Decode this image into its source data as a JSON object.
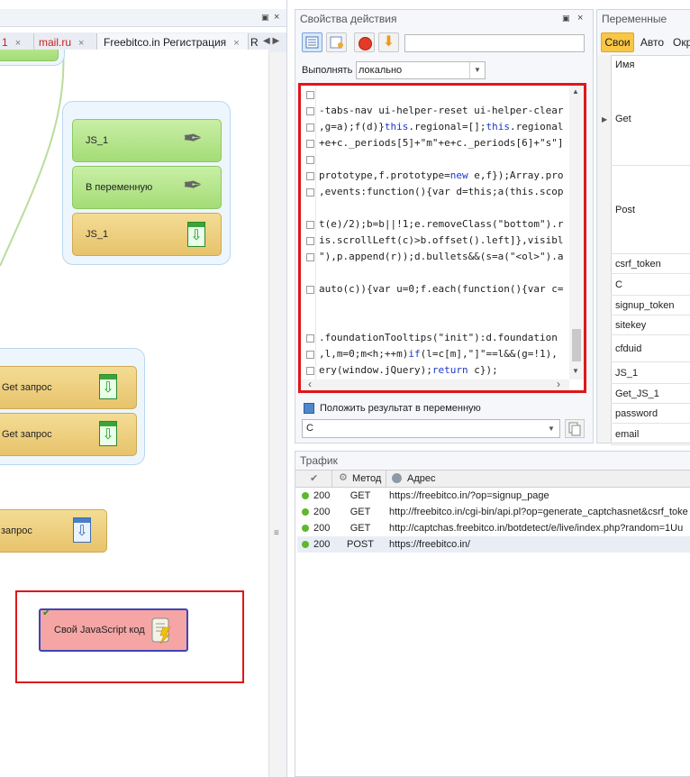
{
  "left_panel": {
    "tabs": [
      {
        "label": "1",
        "red": true
      },
      {
        "label": "mail.ru",
        "red": true
      },
      {
        "label": "Freebitco.in Регистрация",
        "red": false
      },
      {
        "label": "R",
        "red": false
      }
    ],
    "close_glyph": "×",
    "blocks": {
      "js1_top": "JS_1",
      "to_var": "В переменную",
      "js1_orange": "JS_1",
      "get1": "Get запрос",
      "get2": "Get запрос",
      "post": "запрос",
      "custom_js": "Свой JavaScript код"
    }
  },
  "action_panel": {
    "title": "Свойства действия",
    "execute_label": "Выполнять",
    "execute_value": "локально",
    "code_lines": [
      {
        "text": "",
        "fold": true
      },
      {
        "text": "-tabs-nav ui-helper-reset ui-helper-clear",
        "fold": true
      },
      {
        "pre": ",g=a);f(d)}",
        "kw1": "this",
        "mid": ".regional=[];",
        "kw2": "this",
        "post": ".regional",
        "fold": true
      },
      {
        "text": "+e+c._periods[5]+\"m\"+e+c._periods[6]+\"s\"]",
        "fold": true
      },
      {
        "text": "",
        "fold": true
      },
      {
        "pre": "prototype,f.prototype=",
        "kw1": "new",
        "mid": " e,f});Array.pro",
        "fold": true
      },
      {
        "text": ",events:function(){var d=this;a(this.scop",
        "fold": true
      },
      {
        "text": "",
        "fold": false
      },
      {
        "text": "t(e)/2);b=b||!1;e.removeClass(\"bottom\").r",
        "fold": true
      },
      {
        "text": "is.scrollLeft(c)>b.offset().left]},visibl",
        "fold": true
      },
      {
        "text": "\"),p.append(r));d.bullets&&(s=a(\"<ol>\").a",
        "fold": true
      },
      {
        "text": "",
        "fold": false
      },
      {
        "text": "auto(c)){var u=0;f.each(function(){var c=",
        "fold": true
      },
      {
        "text": "",
        "fold": false
      },
      {
        "text": "",
        "fold": false
      },
      {
        "text": ".foundationTooltips(\"init\"):d.foundation",
        "fold": true
      },
      {
        "pre": ",l,m=0;m<h;++m)",
        "kw1": "if",
        "mid": "(l=c[m],\"]\"==l&&(g=!1),",
        "fold": true
      },
      {
        "pre": "ery(window.jQuery);",
        "kw1": "return",
        "mid": " c});",
        "fold": true
      }
    ],
    "save_result_label": "Положить результат в переменную",
    "result_var": "C"
  },
  "variables_panel": {
    "title": "Переменные",
    "tabs": [
      "Свои",
      "Авто",
      "Окр"
    ],
    "col_name": "Имя",
    "rows": [
      "Get",
      "Post",
      "csrf_token",
      "C",
      "signup_token",
      "sitekey",
      "cfduid",
      "JS_1",
      "Get_JS_1",
      "password",
      "email"
    ]
  },
  "traffic_panel": {
    "title": "Трафик",
    "col_method": "Метод",
    "col_address": "Адрес",
    "rows": [
      {
        "status": "200",
        "method": "GET",
        "url": "https://freebitco.in/?op=signup_page"
      },
      {
        "status": "200",
        "method": "GET",
        "url": "http://freebitco.in/cgi-bin/api.pl?op=generate_captchasnet&csrf_toke"
      },
      {
        "status": "200",
        "method": "GET",
        "url": "http://captchas.freebitco.in/botdetect/e/live/index.php?random=1Uu"
      },
      {
        "status": "200",
        "method": "POST",
        "url": "https://freebitco.in/"
      }
    ]
  },
  "colors": {
    "highlight_red": "#e0161b",
    "selected_tab": "#f9c646",
    "status_green": "#5fb82c"
  }
}
